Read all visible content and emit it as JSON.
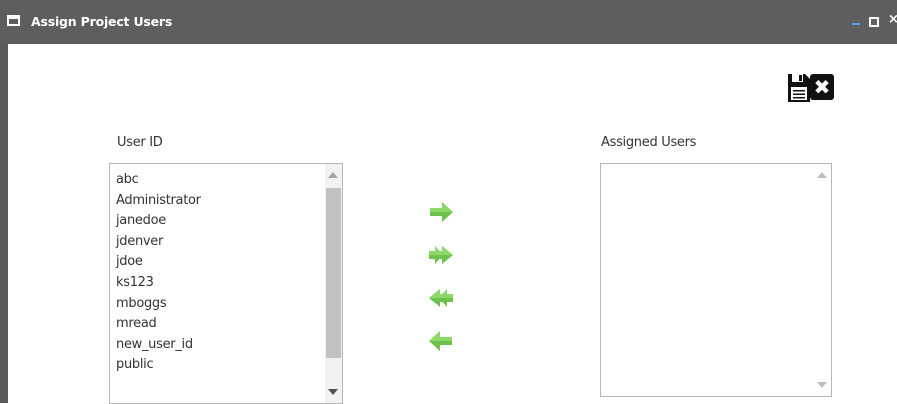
{
  "window": {
    "title": "Assign Project Users",
    "window_icon": "window-icon",
    "controls": {
      "minimize": "minimize-icon",
      "maximize": "maximize-icon",
      "close": "×"
    }
  },
  "toolbar": {
    "save_icon": "floppy-disk-icon",
    "close_icon": "close-icon",
    "close_glyph": "✖"
  },
  "available_users": {
    "label": "User ID",
    "items": [
      "abc",
      "Administrator",
      "janedoe",
      "jdenver",
      "jdoe",
      "ks123",
      "mboggs",
      "mread",
      "new_user_id",
      "public"
    ]
  },
  "assigned_users": {
    "label": "Assigned Users",
    "items": []
  },
  "transfer_buttons": {
    "add": "right-arrow-icon",
    "add_all": "double-right-arrow-icon",
    "remove_all": "double-left-arrow-icon",
    "remove": "left-arrow-icon"
  },
  "colors": {
    "titlebar": "#5e5e5e",
    "accent_arrow": "#6cc24a",
    "minimize_accent": "#4da6ff"
  }
}
